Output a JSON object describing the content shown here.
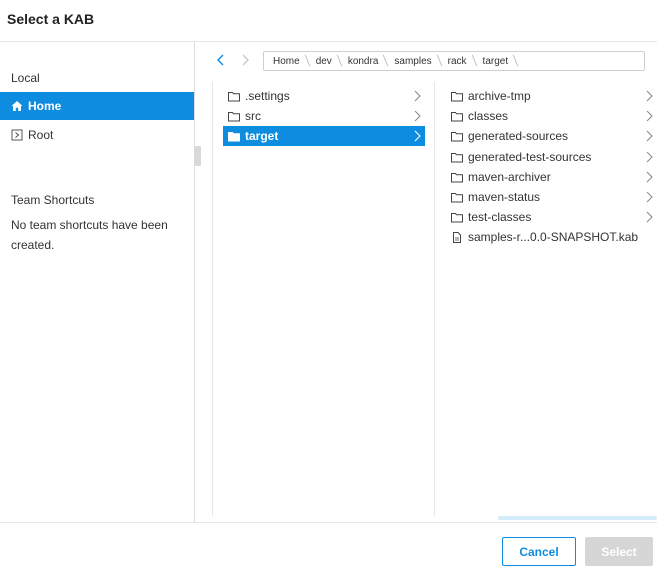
{
  "dialog": {
    "title": "Select a KAB"
  },
  "sidebar": {
    "local_label": "Local",
    "items": [
      {
        "label": "Home",
        "icon": "home-icon",
        "active": true
      },
      {
        "label": "Root",
        "icon": "root-icon",
        "active": false
      }
    ],
    "team_label": "Team Shortcuts",
    "empty_message": "No team shortcuts have been created."
  },
  "breadcrumb": [
    "Home",
    "dev",
    "kondra",
    "samples",
    "rack",
    "target"
  ],
  "columns": {
    "first": [
      {
        "label": ".settings",
        "type": "folder"
      },
      {
        "label": "src",
        "type": "folder"
      },
      {
        "label": "target",
        "type": "folder",
        "selected": true
      }
    ],
    "second": [
      {
        "label": "archive-tmp",
        "type": "folder"
      },
      {
        "label": "classes",
        "type": "folder"
      },
      {
        "label": "generated-sources",
        "type": "folder"
      },
      {
        "label": "generated-test-sources",
        "type": "folder"
      },
      {
        "label": "maven-archiver",
        "type": "folder"
      },
      {
        "label": "maven-status",
        "type": "folder"
      },
      {
        "label": "test-classes",
        "type": "folder"
      },
      {
        "label": "samples-r...0.0-SNAPSHOT.kab",
        "type": "file"
      }
    ]
  },
  "footer": {
    "cancel_label": "Cancel",
    "select_label": "Select"
  },
  "colors": {
    "accent": "#0e8de0",
    "disabled": "#d6d6d6",
    "border": "#dcdcdc"
  }
}
